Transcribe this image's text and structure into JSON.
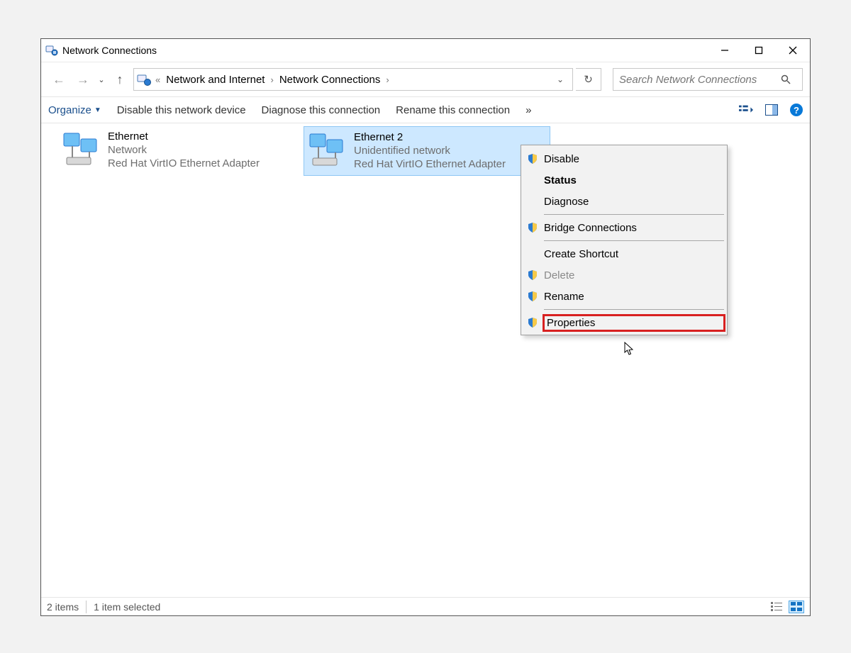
{
  "window": {
    "title": "Network Connections"
  },
  "breadcrumb": {
    "prefix": "«",
    "parts": [
      "Network and Internet",
      "Network Connections"
    ]
  },
  "search": {
    "placeholder": "Search Network Connections"
  },
  "toolbar": {
    "organize": "Organize",
    "disable": "Disable this network device",
    "diagnose": "Diagnose this connection",
    "rename": "Rename this connection",
    "overflow": "»"
  },
  "adapters": [
    {
      "name": "Ethernet",
      "line2": "Network",
      "line3": "Red Hat VirtIO Ethernet Adapter",
      "selected": false
    },
    {
      "name": "Ethernet 2",
      "line2": "Unidentified network",
      "line3": "Red Hat VirtIO Ethernet Adapter",
      "selected": true
    }
  ],
  "context_menu": {
    "items": [
      {
        "label": "Disable",
        "shield": true,
        "bold": false,
        "disabled": false,
        "highlight": false
      },
      {
        "label": "Status",
        "shield": false,
        "bold": true,
        "disabled": false,
        "highlight": false
      },
      {
        "label": "Diagnose",
        "shield": false,
        "bold": false,
        "disabled": false,
        "highlight": false
      },
      {
        "sep": true
      },
      {
        "label": "Bridge Connections",
        "shield": true,
        "bold": false,
        "disabled": false,
        "highlight": false
      },
      {
        "sep": true
      },
      {
        "label": "Create Shortcut",
        "shield": false,
        "bold": false,
        "disabled": false,
        "highlight": false
      },
      {
        "label": "Delete",
        "shield": true,
        "bold": false,
        "disabled": true,
        "highlight": false
      },
      {
        "label": "Rename",
        "shield": true,
        "bold": false,
        "disabled": false,
        "highlight": false
      },
      {
        "sep": true
      },
      {
        "label": "Properties",
        "shield": true,
        "bold": false,
        "disabled": false,
        "highlight": true
      }
    ]
  },
  "statusbar": {
    "items_count": "2 items",
    "selected": "1 item selected"
  }
}
